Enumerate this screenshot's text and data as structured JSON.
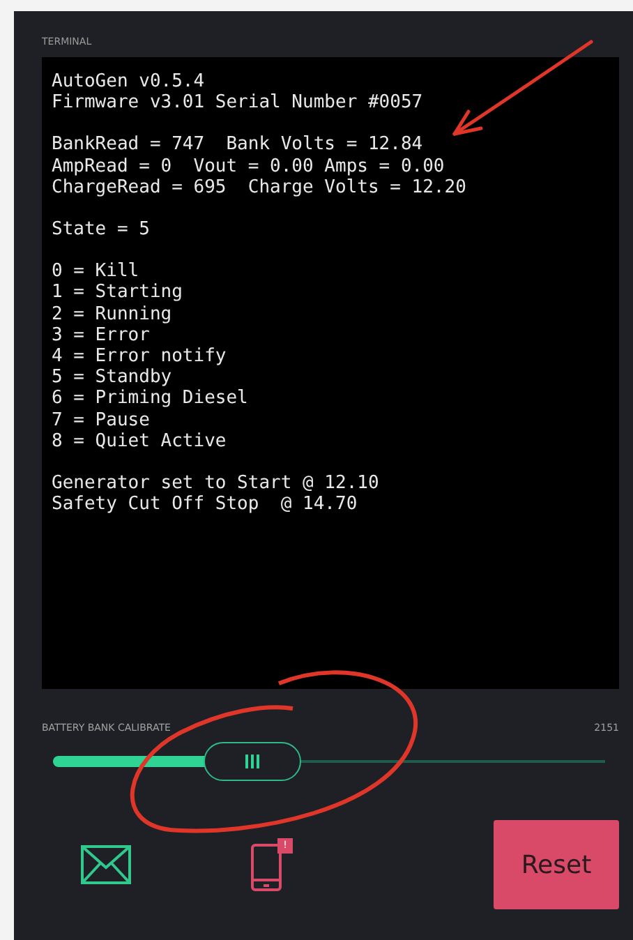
{
  "terminal": {
    "label": "TERMINAL",
    "blocks": [
      [
        "AutoGen v0.5.4",
        "Firmware v3.01 Serial Number #0057"
      ],
      [
        "BankRead = 747  Bank Volts = 12.84",
        "AmpRead = 0  Vout = 0.00 Amps = 0.00",
        "ChargeRead = 695  Charge Volts = 12.20"
      ],
      [
        "State = 5"
      ],
      [
        "0 = Kill",
        "1 = Starting",
        "2 = Running",
        "3 = Error",
        "4 = Error notify",
        "5 = Standby",
        "6 = Priming Diesel",
        "7 = Pause",
        "8 = Quiet Active"
      ],
      [
        "Generator set to Start @ 12.10",
        "Safety Cut Off Stop  @ 14.70"
      ]
    ]
  },
  "slider": {
    "label": "BATTERY BANK CALIBRATE",
    "reading": "2151",
    "level": 0.36
  },
  "notification_badge": "!",
  "reset_button": {
    "label": "Reset"
  }
}
